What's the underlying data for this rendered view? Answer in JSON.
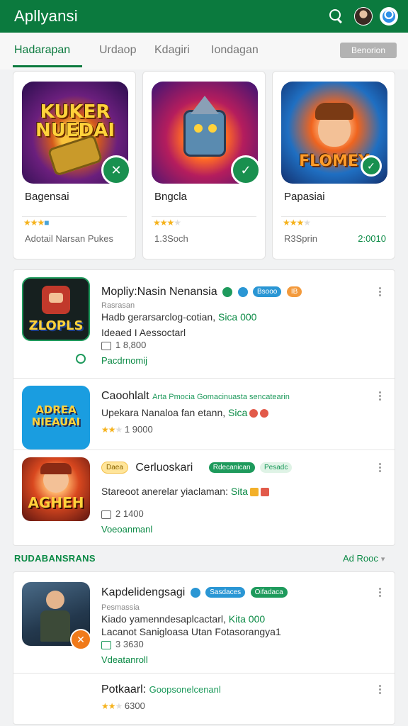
{
  "appbar": {
    "title": "Apllyansi",
    "icons": [
      "search-icon",
      "profile-avatar",
      "account-icon"
    ]
  },
  "tabs": {
    "items": [
      "Hadarapan",
      "Urdaop",
      "Kdagiri",
      "Iondagan"
    ],
    "active_index": 0,
    "button_label": "Benorion"
  },
  "featured": [
    {
      "image_text": "KUKER NUEDAI",
      "name": "Bagensai",
      "meta": "Adotail Narsan Pukes",
      "price": "",
      "badge": "check-x-icon"
    },
    {
      "image_text": "",
      "name": "Bngcla",
      "meta": "1.3Soch",
      "price": "",
      "badge": "check-icon"
    },
    {
      "image_text": "FLOMEY",
      "name": "Papasiai",
      "meta": "R3Sprin",
      "price": "2:0010",
      "badge": "check-icon"
    }
  ],
  "list1": [
    {
      "title": "Mopliy:Nasin Nenansia",
      "pills": [
        "Bsooo",
        "IB"
      ],
      "small": "Rasrasan",
      "desc": "Hadb gerarsarclog-cotian, ",
      "desc_highlight": "Sica 000",
      "sub": "Ideaed I Aessoctarl",
      "downloads": "1 8,800",
      "status": "Pacdrnomij",
      "thumb_text": "ZLOPLS"
    },
    {
      "title": "Caoohlalt",
      "title_extra": "Arta Pmocia Gomacinuasta sencatearin",
      "desc": "Upekara Nanaloa fan etann, ",
      "desc_highlight": "Sica",
      "downloads": "1 9000",
      "thumb_text": "ADREA NIEAUAI"
    },
    {
      "title": "Cerluoskari",
      "pre_pill": "Daea",
      "pills": [
        "Rdecanican",
        "Pesadc"
      ],
      "desc": "Stareoot anerelar yiaclaman: ",
      "desc_highlight": "Sita",
      "downloads": "2 1400",
      "status": "Voeoanmanl",
      "thumb_text": "AGHEH"
    }
  ],
  "section": {
    "title": "RUDABANSRANS",
    "link": "Ad Rooc"
  },
  "list2": [
    {
      "title": "Kapdelidengsagi",
      "pills": [
        "Sasdaces",
        "Oifadaca"
      ],
      "small": "Pesmassia",
      "desc": "Kiado yamenndesaplcactarl, ",
      "desc_highlight": "Kita 000",
      "sub": "Lacanot Sanigloasa Utan Fotasorangya1",
      "downloads": "3 3630",
      "status": "Vdeatanroll"
    },
    {
      "title": "Potkaarl:",
      "title_extra": "Goopsonelcenanl",
      "downloads": "6300"
    }
  ],
  "colors": {
    "brand": "#0b7a3e",
    "accent": "#0b8a45",
    "star": "#f5b21c"
  }
}
